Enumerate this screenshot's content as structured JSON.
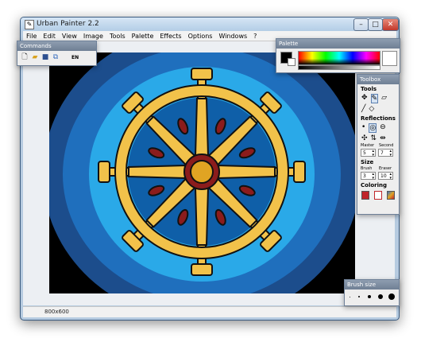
{
  "window": {
    "title": "Urban Painter 2.2",
    "controls": {
      "minimize": "–",
      "maximize": "□",
      "close": "✕"
    }
  },
  "menu": [
    "File",
    "Edit",
    "View",
    "Image",
    "Tools",
    "Palette",
    "Effects",
    "Options",
    "Windows",
    "?"
  ],
  "status": {
    "image_size": "800x600"
  },
  "panels": {
    "commands": {
      "title": "Commands",
      "icons": [
        "new-file-icon",
        "open-folder-icon",
        "save-icon",
        "copy-icon"
      ],
      "language": "EN"
    },
    "palette": {
      "title": "Palette"
    },
    "toolbox": {
      "title": "Toolbox",
      "tools_heading": "Tools",
      "tool_icons": [
        "move-icon",
        "pen-icon",
        "eraser-icon",
        "line-icon",
        "fill-icon"
      ],
      "reflections_heading": "Reflections",
      "reflection_icons": [
        "point-icon",
        "circle-target-icon",
        "circle-minus-icon",
        "four-way-icon",
        "vertical-mirror-icon",
        "horizontal-mirror-icon"
      ],
      "master_label": "Master",
      "second_label": "Second",
      "master_value": "5",
      "second_value": "7",
      "size_heading": "Size",
      "brush_label": "Brush",
      "eraser_label": "Eraser",
      "brush_value": "3",
      "eraser_value": "10",
      "coloring_heading": "Coloring",
      "coloring_icons": [
        "color-fill-icon",
        "color-outline-icon",
        "color-gradient-icon"
      ]
    },
    "brushsize": {
      "title": "Brush size",
      "selected": 3
    }
  },
  "colors": {
    "outer_dark_blue": "#1c4d8c",
    "mid_blue": "#1f6fbd",
    "light_blue": "#2aa9e8",
    "inner_blue": "#0f5fa8",
    "gold": "#f2c24a",
    "dark_red": "#8b1c1c",
    "outline": "#111111"
  }
}
